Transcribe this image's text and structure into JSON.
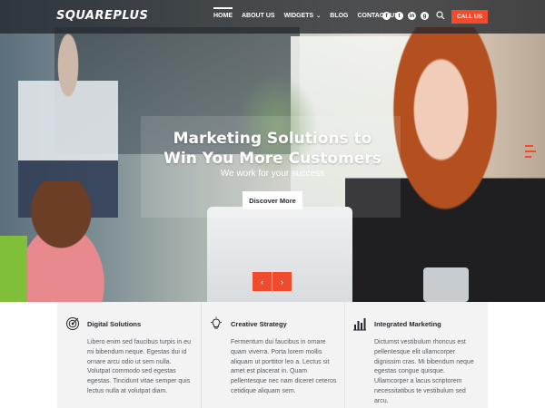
{
  "nav": {
    "logo": "SQUAREPLUS",
    "menu": [
      {
        "label": "HOME"
      },
      {
        "label": "ABOUT US"
      },
      {
        "label": "WIDGETS"
      },
      {
        "label": "BLOG"
      },
      {
        "label": "CONTACT US"
      }
    ],
    "social": [
      "f",
      "t",
      "in",
      "g"
    ],
    "call_label": "CALL US"
  },
  "hero": {
    "title_line1": "Marketing Solutions to",
    "title_line2": "Win You More Customers",
    "subtitle": "We work for your success",
    "cta": "Discover More",
    "prev_arrow": "‹",
    "next_arrow": "›"
  },
  "features": [
    {
      "icon": "target-icon",
      "title": "Digital Solutions",
      "text": "Libero enim sed faucibus turpis in eu mi bibendum neque. Egestas dui id ornare arcu odio ut sem nulla. Volutpat commodo sed egestas egestas. Tincidunt vitae semper quis lectus nulla at volutpat diam."
    },
    {
      "icon": "lightbulb-icon",
      "title": "Creative Strategy",
      "text": "Fermentum dui faucibus in ornare quam viverra. Porta lorem mollis aliquam ut porttitor leo a. Lectus sit amet est placerat in. Quam pellentesque nec nam diceret ceteros cetidique aliquam sem."
    },
    {
      "icon": "bar-chart-icon",
      "title": "Integrated Marketing",
      "text": "Dictumst vestibulum rhoncus est pellentesque elit ullamcorper dignissim cras. Mi bibendum neque egestas congue quisque. Ullamcorper a lacus scriptorem necessitatibus te vestibulum sed arcu."
    }
  ],
  "colors": {
    "accent": "#f04b2c",
    "nav_bg": "#23262c",
    "features_bg": "#f3f3f3"
  }
}
